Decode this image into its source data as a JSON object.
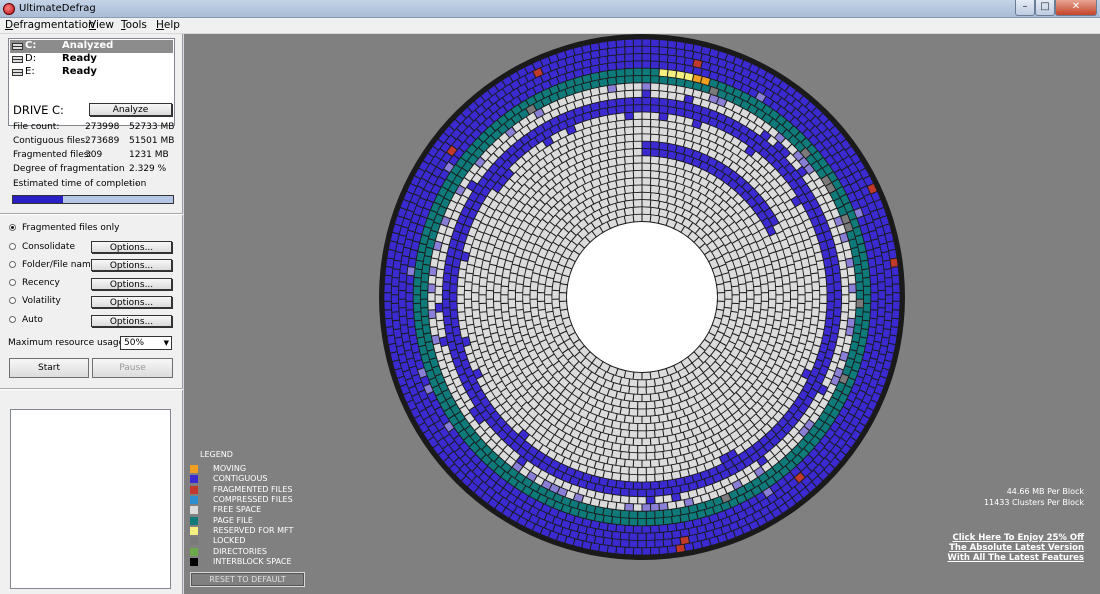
{
  "window": {
    "title": "UltimateDefrag",
    "min_label": "–",
    "max_label": "□",
    "close_label": "✕"
  },
  "menu": [
    {
      "mnemonic": "D",
      "rest": "efragmentation"
    },
    {
      "mnemonic": "V",
      "rest": "iew"
    },
    {
      "mnemonic": "T",
      "rest": "ools"
    },
    {
      "mnemonic": "H",
      "rest": "elp"
    }
  ],
  "drives": [
    {
      "name": "C:",
      "status": "Analyzed",
      "selected": true
    },
    {
      "name": "D:",
      "status": "Ready",
      "selected": false
    },
    {
      "name": "E:",
      "status": "Ready",
      "selected": false
    }
  ],
  "drive_panel": {
    "title": "DRIVE C:",
    "analyze_label": "Analyze",
    "stats": [
      {
        "label": "File count:",
        "v1": "273998",
        "v2": "52733 MB"
      },
      {
        "label": "Contiguous files:",
        "v1": "273689",
        "v2": "51501 MB"
      },
      {
        "label": "Fragmented files:",
        "v1": "309",
        "v2": "1231 MB"
      },
      {
        "label": "Degree of fragmentation",
        "v1": "",
        "v2": "2.329 %"
      },
      {
        "label": "Estimated time of completion",
        "v1": "- -",
        "v2": ""
      }
    ],
    "progress_fraction": 0.31,
    "progress_color": "#2a1fc4"
  },
  "options": [
    {
      "label": "Fragmented files only",
      "checked": true,
      "options_button": ""
    },
    {
      "label": "Consolidate",
      "checked": false,
      "options_button": "Options..."
    },
    {
      "label": "Folder/File name",
      "checked": false,
      "options_button": "Options..."
    },
    {
      "label": "Recency",
      "checked": false,
      "options_button": "Options..."
    },
    {
      "label": "Volatility",
      "checked": false,
      "options_button": "Options..."
    },
    {
      "label": "Auto",
      "checked": false,
      "options_button": "Options..."
    }
  ],
  "resource": {
    "label": "Maximum resource usage %",
    "value": "50%"
  },
  "actions": {
    "start": "Start",
    "pause": "Pause"
  },
  "legend": {
    "title": "LEGEND",
    "items": [
      {
        "label": "MOVING",
        "color": "#f0a020"
      },
      {
        "label": "CONTIGUOUS",
        "color": "#3a2ad0"
      },
      {
        "label": "FRAGMENTED FILES",
        "color": "#c0392b"
      },
      {
        "label": "COMPRESSED FILES",
        "color": "#2d8fd0"
      },
      {
        "label": "FREE SPACE",
        "color": "#dcdcdc"
      },
      {
        "label": "PAGE FILE",
        "color": "#0e7a7a"
      },
      {
        "label": "RESERVED FOR MFT",
        "color": "#f5f080"
      },
      {
        "label": "LOCKED",
        "color": "#7a7a7a"
      },
      {
        "label": "DIRECTORIES",
        "color": "#6aaa4a"
      },
      {
        "label": "INTERBLOCK SPACE",
        "color": "#000000"
      }
    ],
    "reset_label": "RESET TO DEFAULT"
  },
  "block_info": {
    "mb_per_block": "44.66 MB Per Block",
    "clusters_per_block": "11433 Clusters Per Block"
  },
  "promo": [
    "Click Here To Enjoy 25% Off",
    "The Absolute Latest Version",
    "With All The Latest Features"
  ],
  "colors": {
    "contiguous": "#3a2ad0",
    "free": "#dcdcdc",
    "page_file": "#0e7a7a",
    "locked": "#7a7a7a",
    "light_purple": "#8a7fd6",
    "fragmented": "#c0392b",
    "mft": "#f5f080",
    "moving": "#f0a020",
    "grid_line": "#1a1a1a",
    "background": "#808080"
  }
}
